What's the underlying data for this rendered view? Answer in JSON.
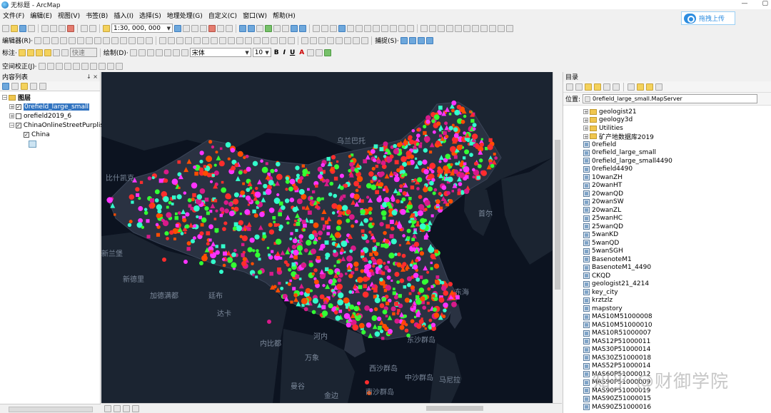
{
  "window": {
    "title": "无标题 - ArcMap",
    "controls": [
      "—",
      "▢"
    ]
  },
  "menu": {
    "items": [
      "文件(F)",
      "编辑(E)",
      "视图(V)",
      "书签(B)",
      "插入(I)",
      "选择(S)",
      "地理处理(G)",
      "自定义(C)",
      "窗口(W)",
      "帮助(H)"
    ]
  },
  "upload_button": {
    "label": "拖拽上传"
  },
  "toolbar1": {
    "scale": "1:30, 000, 000"
  },
  "toolbar2": {
    "editor_label": "编辑器(R)·",
    "snapping_label": "捕捉(S)·"
  },
  "toolbar3": {
    "label_label": "标注·",
    "quick_label": "快速",
    "draw_label": "绘制(D)·",
    "font_name": "宋体",
    "font_size": "10",
    "bold": "B",
    "italic": "I",
    "underline": "U",
    "font_color": "A"
  },
  "toolbar4": {
    "spatial_adjust_label": "空间校正(J)·"
  },
  "toc": {
    "title": "内容列表",
    "pin": "↓ ×",
    "root": "图层",
    "layers": [
      {
        "name": "0refield_large_small",
        "checked": true,
        "selected": true
      },
      {
        "name": "orefield2019_6",
        "checked": false,
        "selected": false
      },
      {
        "name": "ChinaOnlineStreetPurplis",
        "checked": true,
        "selected": false
      }
    ],
    "sublayer": "China"
  },
  "map": {
    "labels": [
      {
        "text": "乌兰巴托"
      },
      {
        "text": "比什凯克"
      },
      {
        "text": "首尔"
      },
      {
        "text": "新兰堡"
      },
      {
        "text": "新德里"
      },
      {
        "text": "加德满都"
      },
      {
        "text": "廷布"
      },
      {
        "text": "达卡"
      },
      {
        "text": "内比都"
      },
      {
        "text": "河内"
      },
      {
        "text": "万象"
      },
      {
        "text": "东海"
      },
      {
        "text": "马尼拉"
      },
      {
        "text": "曼谷"
      },
      {
        "text": "金边"
      },
      {
        "text": "东沙群岛"
      },
      {
        "text": "西沙群岛"
      },
      {
        "text": "中沙群岛"
      },
      {
        "text": "南沙群岛"
      }
    ]
  },
  "catalog": {
    "title": "目录",
    "location_label": "位置:",
    "location_value": "0refield_large_small.MapServer",
    "folders": [
      "geologist21",
      "geology3d",
      "Utilities",
      "矿产地数据库2019"
    ],
    "services": [
      "0refield",
      "0refield_large_small",
      "0refield_large_small4490",
      "0refield4490",
      "10wanZH",
      "20wanHT",
      "20wanQD",
      "20wanSW",
      "20wanZL",
      "25wanHC",
      "25wanQD",
      "5wanKD",
      "5wanQD",
      "5wanSGH",
      "BasenoteM1",
      "BasenoteM1_4490",
      "CKQD",
      "geologist21_4214",
      "key_city",
      "krztzlz",
      "mapstory",
      "MAS10M51000008",
      "MAS10M51000010",
      "MAS10R51000007",
      "MAS12P51000011",
      "MAS30P51000014",
      "MAS30Z51000018",
      "MAS52P51000014",
      "MAS60P51000012",
      "MAS90P51000009",
      "MAS90P51000019",
      "MAS90Z51000015",
      "MAS90Z51000016"
    ]
  },
  "watermark": "知乎 @财御学院",
  "colors": {
    "map_bg": "#0c1320",
    "land": "#1d2634",
    "china_fill": "#2a3242",
    "points": [
      "#ff2d2d",
      "#ff33ff",
      "#33ff33",
      "#33ffcc",
      "#d81a8a",
      "#ff4d00"
    ]
  }
}
